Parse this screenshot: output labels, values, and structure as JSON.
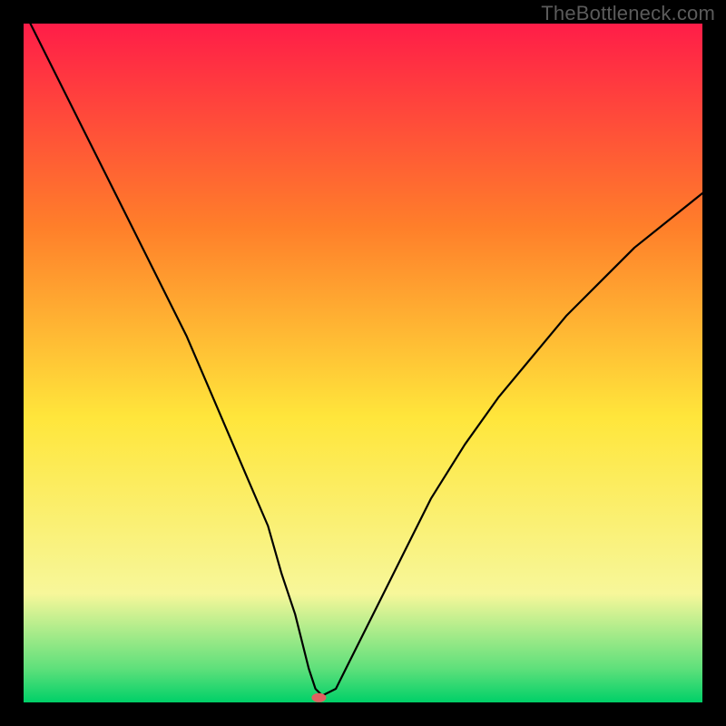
{
  "watermark": "TheBottleneck.com",
  "chart_data": {
    "type": "line",
    "title": "",
    "xlabel": "",
    "ylabel": "",
    "xlim": [
      0,
      100
    ],
    "ylim": [
      0,
      100
    ],
    "series": [
      {
        "name": "curve",
        "x": [
          0,
          4,
          8,
          12,
          16,
          20,
          24,
          27,
          30,
          33,
          36,
          38,
          40,
          41,
          42,
          43,
          44,
          46,
          48,
          52,
          56,
          60,
          65,
          70,
          75,
          80,
          85,
          90,
          95,
          100
        ],
        "values": [
          102,
          94,
          86,
          78,
          70,
          62,
          54,
          47,
          40,
          33,
          26,
          19,
          13,
          9,
          5,
          2,
          1,
          2,
          6,
          14,
          22,
          30,
          38,
          45,
          51,
          57,
          62,
          67,
          71,
          75
        ]
      }
    ],
    "background_gradient": {
      "top": "#ff1d48",
      "upper_mid": "#ff7f2a",
      "mid": "#ffe63b",
      "lower_mid": "#f7f79a",
      "bottom_band": "#5fe07b",
      "bottom": "#00d068"
    },
    "marker": {
      "x": 43.5,
      "y": 0.7,
      "color": "#e06060"
    }
  }
}
